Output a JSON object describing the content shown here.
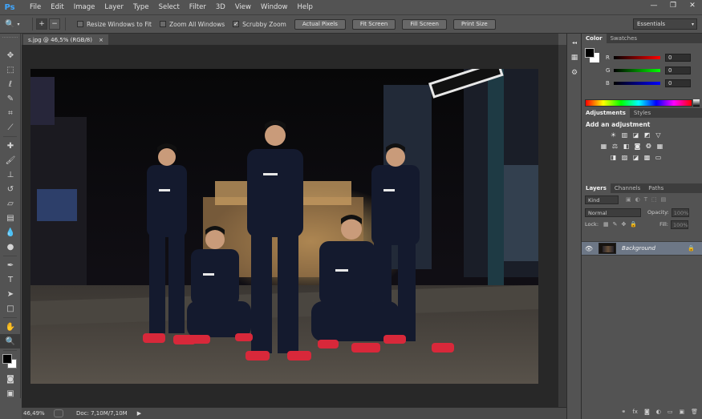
{
  "app": {
    "logo": "Ps"
  },
  "menu": [
    "File",
    "Edit",
    "Image",
    "Layer",
    "Type",
    "Select",
    "Filter",
    "3D",
    "View",
    "Window",
    "Help"
  ],
  "window_controls": {
    "minimize": "—",
    "restore": "❐",
    "close": "✕"
  },
  "options_bar": {
    "tool_icon": "zoom-icon",
    "zoom_in": "+",
    "zoom_out": "−",
    "resize_windows": "Resize Windows to Fit",
    "zoom_all_windows": "Zoom All Windows",
    "scrubby_zoom": "Scrubby Zoom",
    "actual_pixels": "Actual Pixels",
    "fit_screen": "Fit Screen",
    "fill_screen": "Fill Screen",
    "print_size": "Print Size",
    "workspace": "Essentials"
  },
  "document": {
    "tab_title": "s.jpg @ 46,5% (RGB/8)",
    "tab_close": "×"
  },
  "status": {
    "zoom": "46,49%",
    "doc_size": "Doc: 7,10M/7,10M"
  },
  "color_panel": {
    "tabs": [
      "Color",
      "Swatches"
    ],
    "channels": [
      {
        "label": "R",
        "value": "0"
      },
      {
        "label": "G",
        "value": "0"
      },
      {
        "label": "B",
        "value": "0"
      }
    ]
  },
  "adjustments_panel": {
    "tabs": [
      "Adjustments",
      "Styles"
    ],
    "title": "Add an adjustment"
  },
  "layers_panel": {
    "tabs": [
      "Layers",
      "Channels",
      "Paths"
    ],
    "kind": "Kind",
    "blend_mode": "Normal",
    "opacity_label": "Opacity:",
    "opacity_value": "100%",
    "lock_label": "Lock:",
    "fill_label": "Fill:",
    "fill_value": "100%",
    "layers": [
      {
        "name": "Background",
        "visible": true,
        "locked": true
      }
    ]
  },
  "colors": {
    "accent": "#3fa7ff",
    "foreground": "#000000",
    "background": "#ffffff"
  }
}
